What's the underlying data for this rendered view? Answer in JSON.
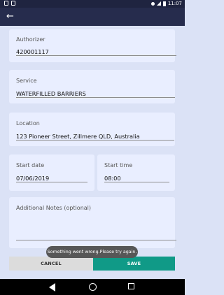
{
  "status_bar": {
    "time": "11:07"
  },
  "fields": {
    "authorizer": {
      "label": "Authorizer",
      "value": "420001117"
    },
    "service": {
      "label": "Service",
      "value": "WATERFILLED BARRIERS"
    },
    "location": {
      "label": "Location",
      "value": "123 Pioneer Street, Zillmere QLD, Australia"
    },
    "start_date": {
      "label": "Start date",
      "value": "07/06/2019"
    },
    "start_time": {
      "label": "Start time",
      "value": "08:00"
    },
    "additional_notes": {
      "label": "Additional Notes (optional)",
      "value": ""
    }
  },
  "toast": {
    "message": "Something went wrong.Please try again."
  },
  "buttons": {
    "cancel": "CANCEL",
    "save": "SAVE"
  },
  "icons": {
    "back": "arrow-back-icon",
    "nav_back": "triangle-back-icon",
    "nav_home": "circle-home-icon",
    "nav_recent": "square-recent-icon"
  }
}
